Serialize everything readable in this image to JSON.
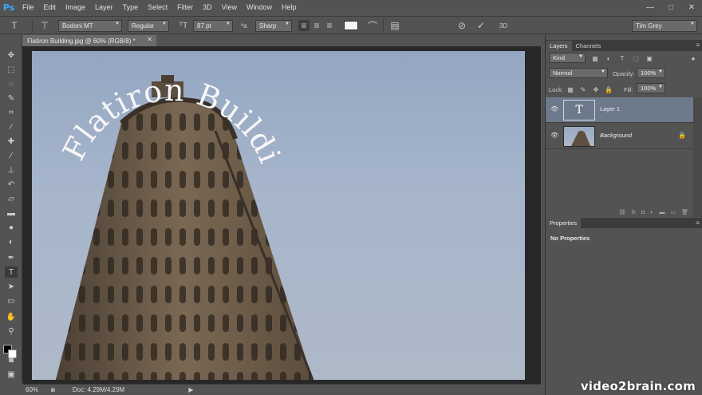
{
  "app": {
    "logo": "Ps"
  },
  "menu": [
    "File",
    "Edit",
    "Image",
    "Layer",
    "Type",
    "Select",
    "Filter",
    "3D",
    "View",
    "Window",
    "Help"
  ],
  "window_controls": [
    "—",
    "□",
    "✕"
  ],
  "options": {
    "font_family": "Bodoni MT",
    "font_style": "Regular",
    "font_size": "87 pt",
    "antialias": "Sharp",
    "text_color": "#f4f4f4",
    "workspace": "Tim Grey"
  },
  "document": {
    "tab_title": "Flatiron Building.jpg @ 60% (RGB/8) *",
    "warped_text": "Flatiron Building",
    "zoom": "60%",
    "doc_info": "Doc: 4.29M/4.29M"
  },
  "panels": {
    "tabs": [
      "Layers",
      "Channels"
    ],
    "kind_label": "Kind",
    "blend_mode": "Normal",
    "opacity_label": "Opacity:",
    "opacity_value": "100%",
    "lock_label": "Lock:",
    "fill_label": "Fill:",
    "fill_value": "100%",
    "layers": [
      {
        "name": "Layer 1",
        "type": "text",
        "selected": true
      },
      {
        "name": "Background",
        "type": "image",
        "selected": false
      }
    ],
    "properties_title": "Properties",
    "properties_body": "No Properties"
  },
  "watermark": "video2brain.com",
  "colors": {
    "accent": "#3ea8ff",
    "panel_bg": "#535353",
    "selected_layer": "#6d7a8c"
  }
}
